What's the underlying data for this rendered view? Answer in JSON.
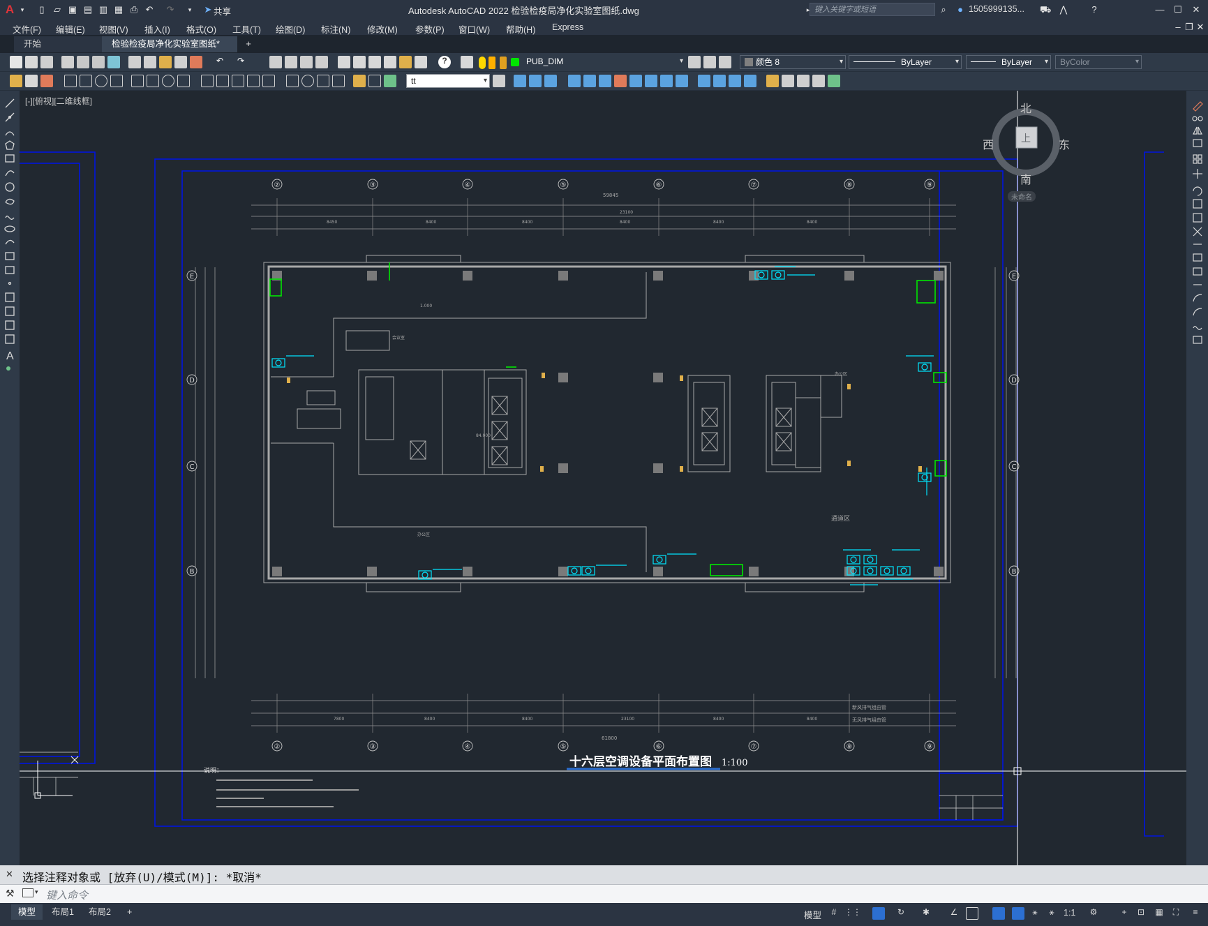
{
  "app": {
    "title": "Autodesk AutoCAD 2022    检验检疫局净化实验室图纸.dwg",
    "share_label": "共享",
    "search_placeholder": "键入关键字或短语",
    "user": "1505999135...",
    "logo": "A"
  },
  "menu": [
    "文件(F)",
    "编辑(E)",
    "视图(V)",
    "插入(I)",
    "格式(O)",
    "工具(T)",
    "绘图(D)",
    "标注(N)",
    "修改(M)",
    "参数(P)",
    "窗口(W)",
    "帮助(H)",
    "Express"
  ],
  "tabs": {
    "start": "开始",
    "active": "检验检疫局净化实验室图纸*",
    "close": "×",
    "add": "+"
  },
  "toolbar": {
    "layer": "PUB_DIM",
    "color": "颜色 8",
    "linetype": "ByLayer",
    "lineweight": "ByLayer",
    "plotstyle": "ByColor",
    "textstyle": "tt"
  },
  "viewport": {
    "label": "[-][俯视][二维线框]",
    "viewcube": {
      "north": "北",
      "south": "南",
      "east": "东",
      "west": "西",
      "top": "上",
      "ucs": "未命名"
    }
  },
  "drawing": {
    "title": "十六层空调设备平面布置图",
    "scale": "1:100",
    "axes_top": [
      "②",
      "③",
      "④",
      "⑤",
      "⑥",
      "⑦",
      "⑧",
      "⑨"
    ],
    "axes_side": [
      "E",
      "D",
      "C",
      "B"
    ],
    "notes_title": "说明：",
    "total_dim": "61800",
    "area_label": "通道区"
  },
  "command": {
    "history": "选择注释对象或 [放弃(U)/模式(M)]: *取消*",
    "placeholder": "键入命令"
  },
  "status": {
    "layouts": [
      "模型",
      "布局1",
      "布局2"
    ],
    "add": "+",
    "model": "模型",
    "scale": "1:1"
  },
  "colors": {
    "bg": "#212830",
    "frame_blue": "#0014e0",
    "wall": "#9a9a9a",
    "equipment_cyan": "#00e5ff",
    "green": "#00e600",
    "accent_blue": "#2c6fd1"
  }
}
